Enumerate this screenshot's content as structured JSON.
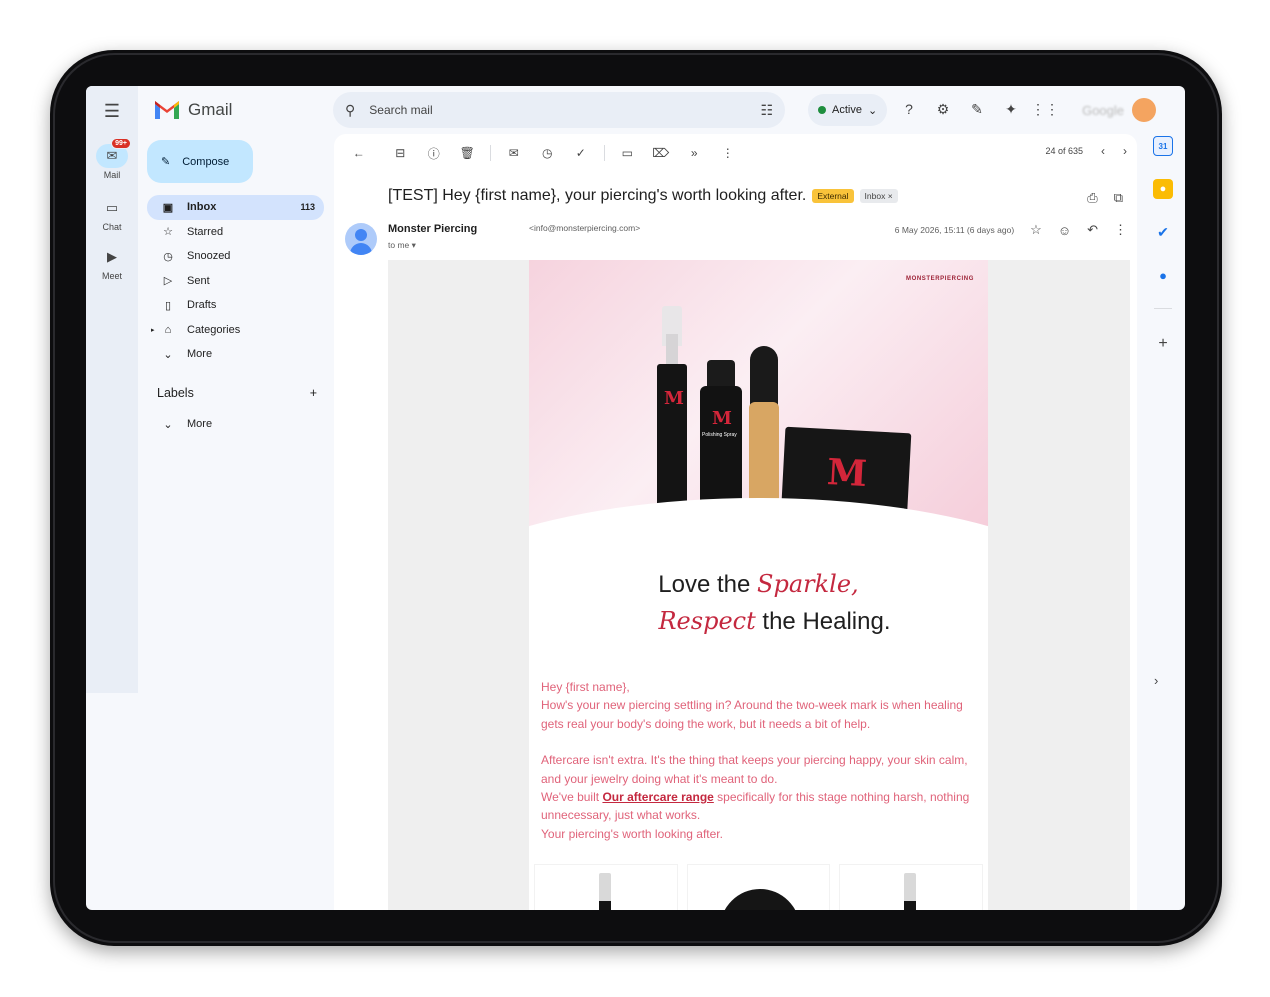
{
  "app": {
    "name": "Gmail"
  },
  "rail": {
    "items": [
      {
        "label": "Mail",
        "badge": "99+"
      },
      {
        "label": "Chat"
      },
      {
        "label": "Meet"
      }
    ]
  },
  "search": {
    "placeholder": "Search mail"
  },
  "status": {
    "label": "Active",
    "color": "#1e8e3e"
  },
  "account": {
    "label": "Google"
  },
  "compose": {
    "label": "Compose"
  },
  "nav": {
    "items": [
      {
        "label": "Inbox",
        "count": "113",
        "icon": "inbox-icon"
      },
      {
        "label": "Starred",
        "icon": "star-icon"
      },
      {
        "label": "Snoozed",
        "icon": "clock-icon"
      },
      {
        "label": "Sent",
        "icon": "send-icon"
      },
      {
        "label": "Drafts",
        "icon": "draft-icon"
      },
      {
        "label": "Categories",
        "icon": "label-icon"
      },
      {
        "label": "More",
        "icon": "chevron-down-icon"
      }
    ]
  },
  "labels": {
    "title": "Labels",
    "more": "More"
  },
  "pager": {
    "text": "24 of 635"
  },
  "message": {
    "subject": "[TEST] Hey {first name}, your piercing's worth looking after.",
    "tags": [
      "External",
      "Inbox"
    ],
    "sender_name": "Monster Piercing",
    "sender_email": "<info@monsterpiercing.com>",
    "to": "to me",
    "date": "6 May 2026, 15:11 (6 days ago)"
  },
  "email": {
    "brand": "MONSTERPIERCING",
    "headline_1a": "Love the",
    "headline_1b": "Sparkle,",
    "headline_2a": "Respect",
    "headline_2b": "the Healing.",
    "greeting": "Hey {first name},",
    "para1": "How's your new piercing settling in? Around the two-week mark is when healing gets real  your body's doing the work, but it needs a bit of help.",
    "para2": "Aftercare isn't extra. It's the thing that keeps your piercing happy, your skin calm, and your jewelry doing what it's meant to do.",
    "para3_pre": "We've built ",
    "para3_link": "Our aftercare range",
    "para3_post": " specifically for this stage nothing harsh, nothing unnecessary, just what works.",
    "para4": "Your piercing's worth looking after.",
    "product_labels": [
      "Polishing Spray"
    ],
    "colors": {
      "accent": "#c4283f",
      "copy": "#e0637a",
      "hero_pink": "#f6d3de"
    }
  }
}
